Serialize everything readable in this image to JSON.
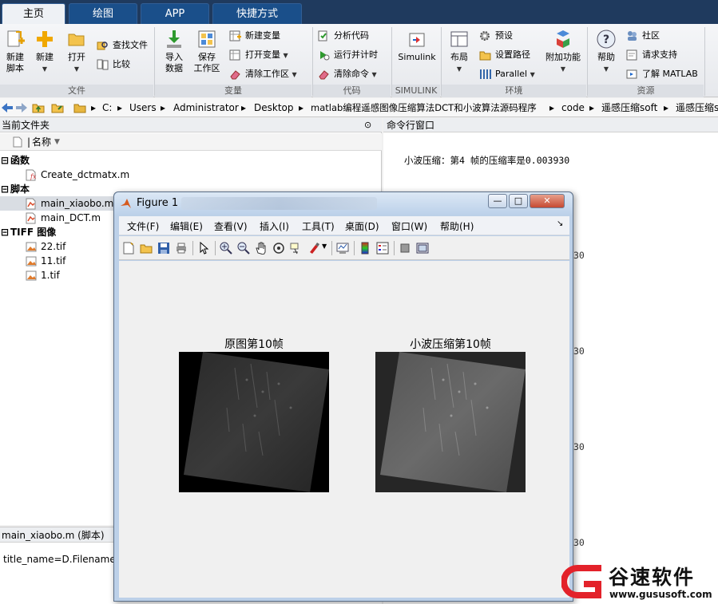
{
  "tabs": [
    {
      "label": "主页",
      "active": true
    },
    {
      "label": "绘图",
      "active": false
    },
    {
      "label": "APP",
      "active": false
    },
    {
      "label": "快捷方式",
      "active": false
    }
  ],
  "ribbon": {
    "file": {
      "new_script": "新建\n脚本",
      "new": "新建",
      "open": "打开",
      "find_files": "查找文件",
      "compare": "比较",
      "group": "文件"
    },
    "variable": {
      "import": "导入\n数据",
      "save_ws": "保存\n工作区",
      "new_var": "新建变量",
      "open_var": "打开变量",
      "clear_ws": "清除工作区",
      "group": "变量"
    },
    "code": {
      "analyze": "分析代码",
      "run_time": "运行并计时",
      "clear_cmd": "清除命令",
      "group": "代码"
    },
    "simulink": {
      "label": "Simulink",
      "group": "SIMULINK"
    },
    "env": {
      "layout": "布局",
      "prefs": "预设",
      "set_path": "设置路径",
      "parallel": "Parallel",
      "addons": "附加功能",
      "group": "环境"
    },
    "resources": {
      "help": "帮助",
      "community": "社区",
      "support": "请求支持",
      "learn": "了解 MATLAB",
      "group": "资源"
    }
  },
  "address": {
    "sep": "▸",
    "crumbs": [
      "C:",
      "Users",
      "Administrator",
      "Desktop",
      "matlab编程遥感图像压缩算法DCT和小波算法源码程序",
      "code",
      "遥感压缩soft",
      "遥感压缩s"
    ]
  },
  "filebrowser": {
    "title": "当前文件夹",
    "col_name": "名称",
    "groups": [
      {
        "label": "函数",
        "files": [
          "Create_dctmatx.m"
        ]
      },
      {
        "label": "脚本",
        "files": [
          "main_xiaobo.m",
          "main_DCT.m"
        ]
      },
      {
        "label": "TIFF 图像",
        "files": [
          "22.tif",
          "11.tif",
          "1.tif"
        ]
      }
    ],
    "selected": "main_xiaobo.m"
  },
  "details": {
    "title": "main_xiaobo.m  (脚本)",
    "code": "title_name=D.Filename;"
  },
  "command": {
    "title": "命令行窗口",
    "line": "小波压缩：第4 帧的压缩率是0.003930",
    "partial_values": [
      "30",
      "30",
      "30",
      "30"
    ]
  },
  "figure": {
    "title": "Figure 1",
    "menus": [
      "文件(F)",
      "编辑(E)",
      "查看(V)",
      "插入(I)",
      "工具(T)",
      "桌面(D)",
      "窗口(W)",
      "帮助(H)"
    ],
    "btn_min": "—",
    "btn_max": "□",
    "btn_close": "✕",
    "axes": [
      {
        "title": "原图第10帧"
      },
      {
        "title": "小波压缩第10帧"
      }
    ]
  },
  "watermark": {
    "name": "谷速软件",
    "url": "www.gususoft.com"
  },
  "colors": {
    "tabbar": "#1f3a5e",
    "tab": "#1a4f8a",
    "selection": "#d9dde3",
    "watermark_red": "#e3222a"
  }
}
